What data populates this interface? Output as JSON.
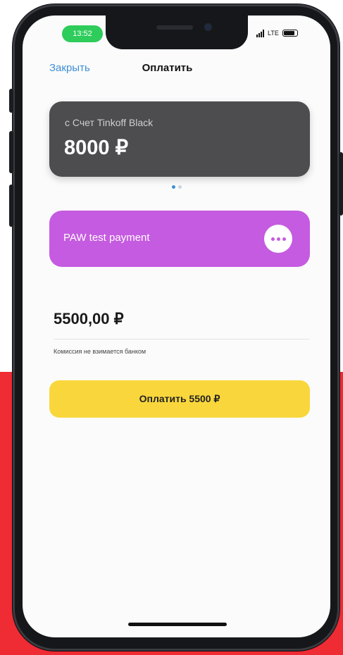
{
  "colors": {
    "background_red": "#ef2b34",
    "close_link": "#3f8fd6",
    "account_card": "#4d4d50",
    "merchant_card": "#c55be0",
    "pay_button": "#f9d73c",
    "status_time_pill": "#2ecc5a"
  },
  "status_bar": {
    "time": "13:52",
    "network": "LTE",
    "icons": [
      "signal-icon",
      "battery-icon"
    ]
  },
  "nav": {
    "close_label": "Закрыть",
    "title": "Оплатить"
  },
  "account_card": {
    "name": "с Счет Tinkoff Black",
    "balance": "8000 ₽"
  },
  "carousel": {
    "page_count": 2,
    "active_index": 0
  },
  "merchant_card": {
    "name": "PAW test payment",
    "more_icon": "more-horizontal-icon"
  },
  "payment": {
    "amount": "5500,00 ₽",
    "fee_note": "Комиссия не взимается банком"
  },
  "pay_button": {
    "label": "Оплатить 5500 ₽"
  }
}
